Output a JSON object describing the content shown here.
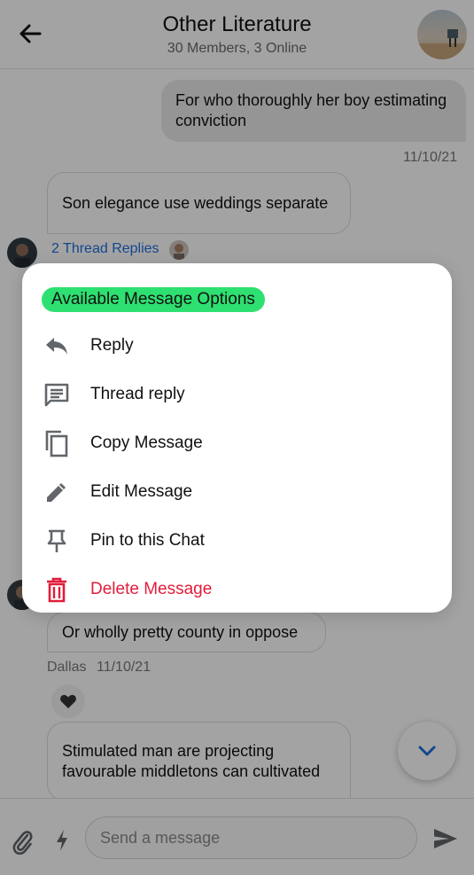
{
  "header": {
    "title": "Other Literature",
    "subtitle": "30 Members, 3 Online",
    "back_icon": "arrow-left-icon"
  },
  "messages": [
    {
      "id": "m1",
      "direction": "outgoing",
      "text": "For who thoroughly her boy estimating conviction",
      "timestamp": "11/10/21"
    },
    {
      "id": "m2",
      "direction": "incoming",
      "text": "Son elegance use weddings separate",
      "thread_replies": "2 Thread Replies"
    },
    {
      "id": "m3",
      "direction": "incoming",
      "text": "Or wholly pretty county in oppose",
      "author": "Dallas",
      "timestamp": "11/10/21",
      "reaction": "heart-icon"
    },
    {
      "id": "m4",
      "direction": "incoming",
      "text": "Stimulated man are projecting favourable middletons can cultivated"
    }
  ],
  "composer": {
    "placeholder": "Send a message",
    "attach_icon": "paperclip-icon",
    "commands_icon": "lightning-icon",
    "send_icon": "send-icon"
  },
  "modal": {
    "title": "Available Message Options",
    "options": [
      {
        "label": "Reply",
        "icon": "reply-icon"
      },
      {
        "label": "Thread reply",
        "icon": "thread-icon"
      },
      {
        "label": "Copy Message",
        "icon": "copy-icon"
      },
      {
        "label": "Edit Message",
        "icon": "pencil-icon"
      },
      {
        "label": "Pin to this Chat",
        "icon": "pin-icon"
      },
      {
        "label": "Delete Message",
        "icon": "trash-icon"
      }
    ]
  },
  "colors": {
    "accent_link": "#1d6fdc",
    "title_highlight": "#2ee071",
    "danger": "#e11d3a",
    "icon_gray": "#62666b"
  }
}
